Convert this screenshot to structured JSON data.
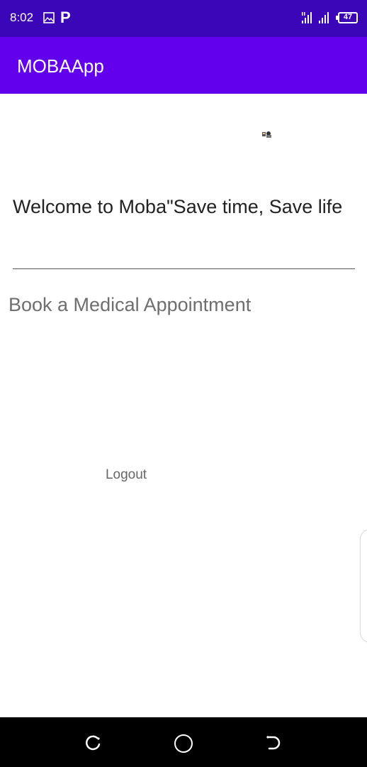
{
  "status_bar": {
    "time": "8:02",
    "notification_letter": "P",
    "battery_level": "47",
    "icons": [
      "gallery-icon",
      "p-icon",
      "signal-icon",
      "battery-icon"
    ]
  },
  "app_bar": {
    "title": "MOBAApp"
  },
  "main": {
    "welcome_text": "Welcome to Moba\"Save time, Save life",
    "book_appointment_text": "Book a Medical Appointment",
    "logout_label": "Logout"
  },
  "nav_bar": {
    "icons": [
      "recent-apps-icon",
      "home-icon",
      "back-icon"
    ]
  },
  "colors": {
    "status_bar": "#3b06b8",
    "app_bar": "#6200ee",
    "nav_bar": "#000000"
  }
}
